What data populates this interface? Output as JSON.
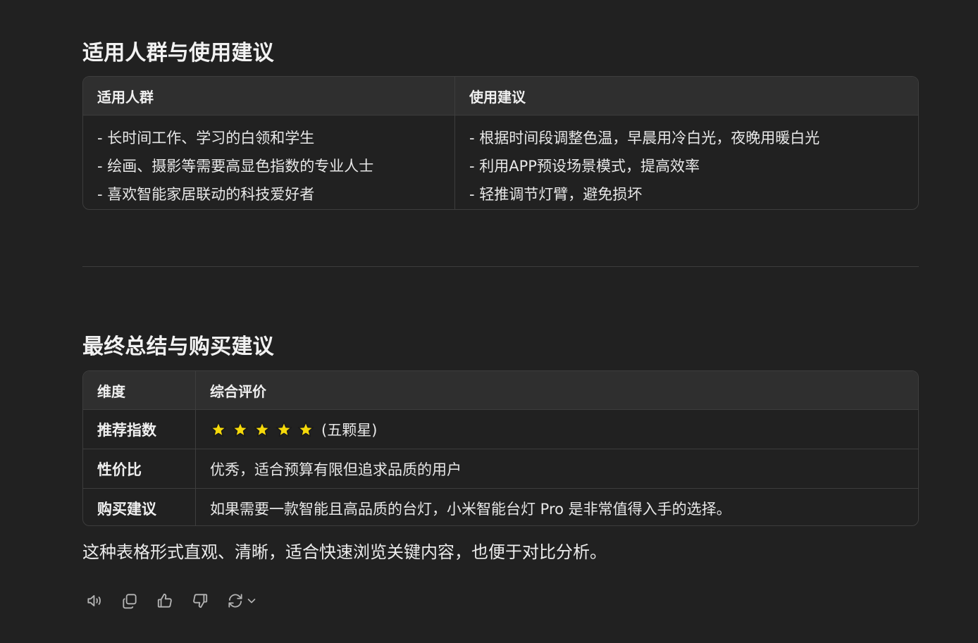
{
  "section1": {
    "title": "适用人群与使用建议",
    "table": {
      "headers": [
        "适用人群",
        "使用建议"
      ],
      "left_items": [
        "- 长时间工作、学习的白领和学生",
        "- 绘画、摄影等需要高显色指数的专业人士",
        "- 喜欢智能家居联动的科技爱好者"
      ],
      "right_items": [
        "- 根据时间段调整色温，早晨用冷白光，夜晚用暖白光",
        "- 利用APP预设场景模式，提高效率",
        "- 轻推调节灯臂，避免损坏"
      ]
    }
  },
  "section2": {
    "title": "最终总结与购买建议",
    "table": {
      "headers": [
        "维度",
        "综合评价"
      ],
      "rows": [
        {
          "label": "推荐指数",
          "value": "(五颗星)",
          "stars": 5
        },
        {
          "label": "性价比",
          "value": "优秀，适合预算有限但追求品质的用户"
        },
        {
          "label": "购买建议",
          "value": "如果需要一款智能且高品质的台灯，小米智能台灯 Pro 是非常值得入手的选择。"
        }
      ]
    }
  },
  "summary": "这种表格形式直观、清晰，适合快速浏览关键内容，也便于对比分析。",
  "actions": {
    "icons": [
      "speaker-icon",
      "copy-icon",
      "thumbs-up-icon",
      "thumbs-down-icon",
      "regenerate-icon",
      "chevron-down-icon"
    ]
  },
  "colors": {
    "background": "#212121",
    "header_bg": "#2f2f2f",
    "border": "#3d3d3d",
    "star": "#f5d90a"
  }
}
